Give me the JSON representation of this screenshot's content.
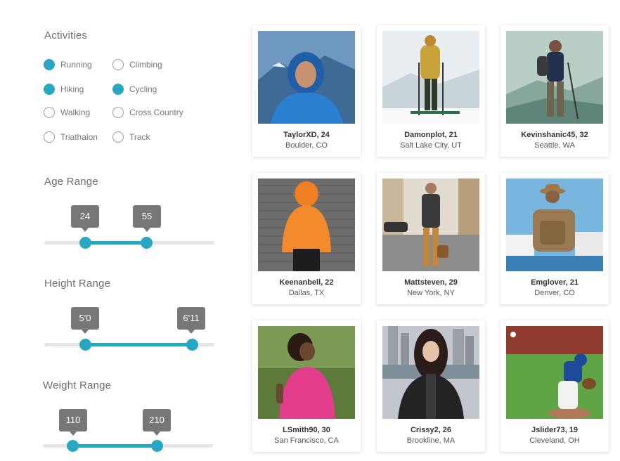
{
  "filters": {
    "activities": {
      "title": "Activities",
      "options": [
        {
          "label": "Running",
          "selected": true
        },
        {
          "label": "Climbing",
          "selected": false
        },
        {
          "label": "Hiking",
          "selected": true
        },
        {
          "label": "Cycling",
          "selected": true
        },
        {
          "label": "Walking",
          "selected": false
        },
        {
          "label": "Cross Country",
          "selected": false
        },
        {
          "label": "Triathalon",
          "selected": false
        },
        {
          "label": "Track",
          "selected": false
        }
      ]
    },
    "age": {
      "title": "Age Range",
      "min_label": "24",
      "max_label": "55"
    },
    "height": {
      "title": "Height Range",
      "min_label": "5'0",
      "max_label": "6'11"
    },
    "weight": {
      "title": "Weight Range",
      "min_label": "110",
      "max_label": "210"
    },
    "accent_color": "#27a8c2"
  },
  "profiles": [
    {
      "name": "TaylorXD, 24",
      "location": "Boulder, CO"
    },
    {
      "name": "Damonplot, 21",
      "location": "Salt Lake City, UT"
    },
    {
      "name": "Kevinshanic45, 32",
      "location": "Seattle, WA"
    },
    {
      "name": "Keenanbell, 22",
      "location": "Dallas, TX"
    },
    {
      "name": "Mattsteven, 29",
      "location": "New York, NY"
    },
    {
      "name": "Emglover, 21",
      "location": "Denver, CO"
    },
    {
      "name": "LSmith90, 30",
      "location": "San Francisco, CA"
    },
    {
      "name": "Crissy2, 26",
      "location": "Brookline, MA"
    },
    {
      "name": "Jslider73, 19",
      "location": "Cleveland, OH"
    }
  ]
}
